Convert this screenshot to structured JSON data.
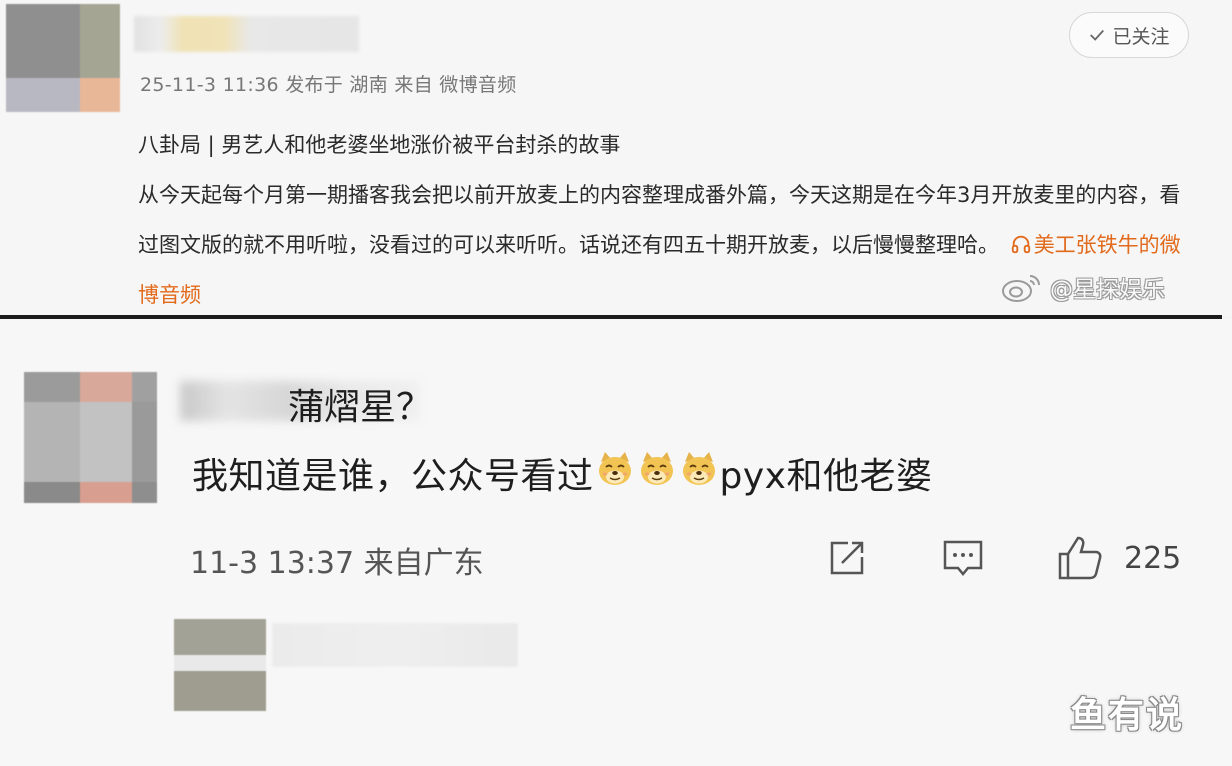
{
  "post": {
    "avatar_colors": [
      "#8f8f8f",
      "#a5a594",
      "#b8b8c2",
      "#e8b798"
    ],
    "follow_button_label": "已关注",
    "meta": "25-11-3 11:36 发布于 湖南 来自 微博音频",
    "title": "八卦局 | 男艺人和他老婆坐地涨价被平台封杀的故事",
    "body": "从今天起每个月第一期播客我会把以前开放麦上的内容整理成番外篇，今天这期是在今年3月开放麦里的内容，看过图文版的就不用听啦，没看过的可以来听听。话说还有四五十期开放麦，以后慢慢整理哈。",
    "audio_link": "美工张铁牛的微博音频",
    "audio_icon": "headphones-icon",
    "accent_color": "#e26a1c"
  },
  "watermark_weibo": "@星探娱乐",
  "comment": {
    "avatar_colors": [
      "#9b9b9b",
      "#d8a89a",
      "#a0a0a0",
      "#b4b4b4",
      "#c2c2c2",
      "#9a9a9a",
      "#8a8a8a",
      "#d89f90",
      "#8e8e8e"
    ],
    "text_before": "我知道是谁，公众号看过",
    "emoji_name": "doge-emoji",
    "text_after": "pyx和他老婆",
    "meta": "11-3 13:37 来自广东",
    "like_count": "225",
    "icons": {
      "share": "share-icon",
      "reply": "comment-icon",
      "like": "thumbs-up-icon"
    }
  },
  "reply": {
    "avatar_colors": [
      "#a3a296",
      "#e9e9e9",
      "#9e9d8f"
    ],
    "text": "蒲熠星？"
  },
  "watermark_site": "鱼有说"
}
